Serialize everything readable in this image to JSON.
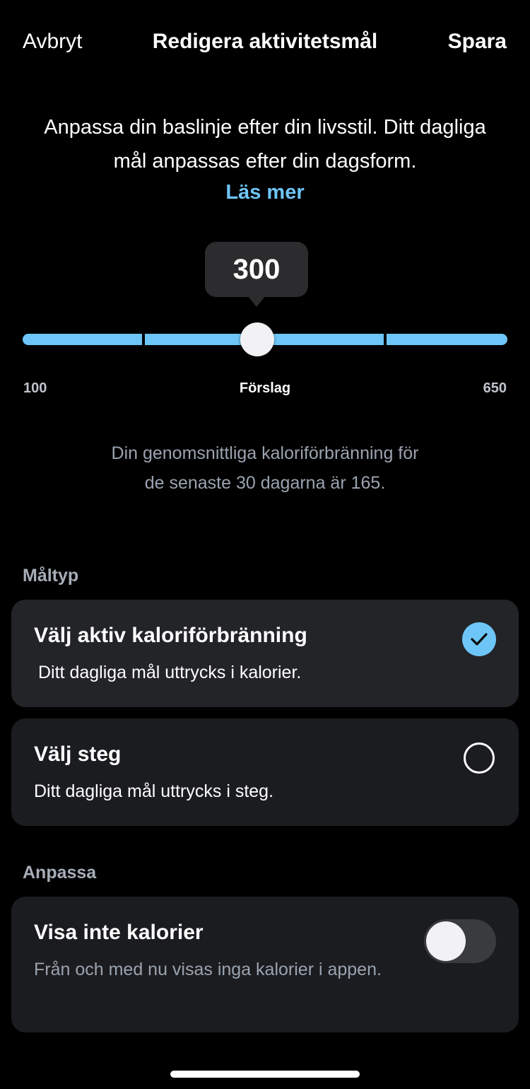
{
  "header": {
    "cancel_label": "Avbryt",
    "title": "Redigera aktivitetsmål",
    "save_label": "Spara"
  },
  "intro": {
    "description": "Anpassa din baslinje efter din livsstil. Ditt dagliga mål anpassas efter din dagsform.",
    "read_more_label": "Läs mer"
  },
  "slider": {
    "value": "300",
    "min_label": "100",
    "mid_label": "Förslag",
    "max_label": "650",
    "accent_color": "#6ec6f8"
  },
  "average_text_line1": "Din genomsnittliga kaloriförbränning för",
  "average_text_line2": "de senaste 30 dagarna är 165.",
  "goal_type": {
    "section_label": "Måltyp",
    "options": [
      {
        "title": "Välj aktiv kaloriförbränning",
        "subtitle": "Ditt dagliga mål uttrycks i kalorier.",
        "selected": true
      },
      {
        "title": "Välj steg",
        "subtitle": "Ditt dagliga mål uttrycks i steg.",
        "selected": false
      }
    ]
  },
  "customize": {
    "section_label": "Anpassa",
    "hide_calories": {
      "title": "Visa inte kalorier",
      "subtitle": "Från och med nu visas inga kalorier i appen.",
      "enabled": false
    }
  },
  "icons": {
    "selected_option": "checkmark-icon",
    "unselected_option": "radio-circle-icon"
  }
}
